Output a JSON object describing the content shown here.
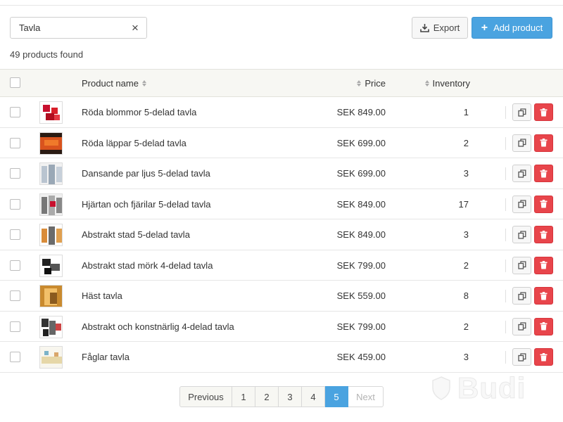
{
  "search": {
    "value": "Tavla",
    "placeholder": ""
  },
  "results": {
    "found_text": "49 products found"
  },
  "toolbar": {
    "export_label": "Export",
    "add_label": "Add product"
  },
  "table": {
    "headers": {
      "name": "Product name",
      "price": "Price",
      "inventory": "Inventory"
    },
    "rows": [
      {
        "name": "Röda blommor 5-delad tavla",
        "price": "SEK 849.00",
        "inventory": "1"
      },
      {
        "name": "Röda läppar 5-delad tavla",
        "price": "SEK 699.00",
        "inventory": "2"
      },
      {
        "name": "Dansande par ljus 5-delad tavla",
        "price": "SEK 699.00",
        "inventory": "3"
      },
      {
        "name": "Hjärtan och fjärilar 5-delad tavla",
        "price": "SEK 849.00",
        "inventory": "17"
      },
      {
        "name": "Abstrakt stad 5-delad tavla",
        "price": "SEK 849.00",
        "inventory": "3"
      },
      {
        "name": "Abstrakt stad mörk 4-delad tavla",
        "price": "SEK 799.00",
        "inventory": "2"
      },
      {
        "name": "Häst tavla",
        "price": "SEK 559.00",
        "inventory": "8"
      },
      {
        "name": "Abstrakt och konstnärlig 4-delad tavla",
        "price": "SEK 799.00",
        "inventory": "2"
      },
      {
        "name": "Fåglar tavla",
        "price": "SEK 459.00",
        "inventory": "3"
      }
    ]
  },
  "pagination": {
    "previous": "Previous",
    "pages": [
      "1",
      "2",
      "3",
      "4",
      "5"
    ],
    "current": "5",
    "next": "Next"
  },
  "watermark": {
    "text": "Budi"
  },
  "colors": {
    "primary": "#4aa3e0",
    "danger": "#e8454b",
    "header_bg": "#f7f7f3"
  },
  "icons": {
    "clear": "close-icon",
    "export": "download-icon",
    "add": "plus-icon",
    "sort": "sort-icon",
    "copy": "copy-icon",
    "delete": "trash-icon"
  }
}
